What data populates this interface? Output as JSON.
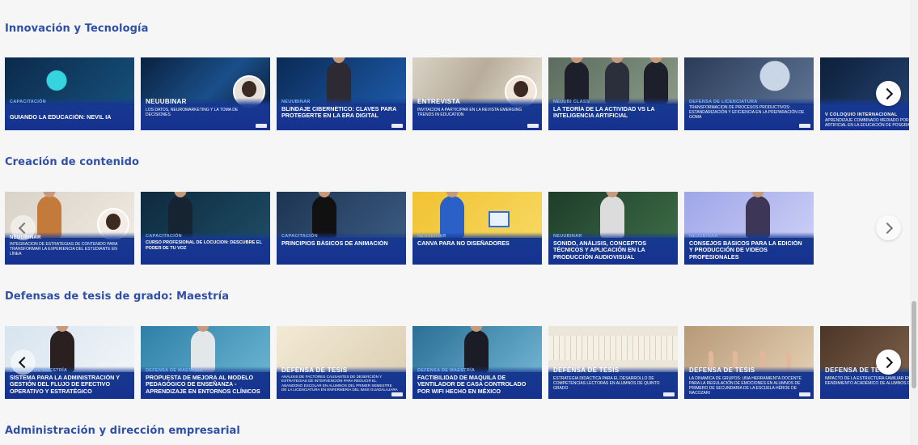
{
  "sections": [
    {
      "title": "Innovación y Tecnología",
      "cards": [
        {
          "tag": "CAPACITACIÓN",
          "title": "GUIANDO LA EDUCACIÓN: NEVIL IA"
        },
        {
          "tag": "NEUUBINAR",
          "title": "LOS DATOS, NEUROMARKETING Y LA TOMA DE DECISIONES"
        },
        {
          "tag": "NEUUBINAR",
          "title": "BLINDAJE CIBERNÉTICO: CLAVES PARA PROTEGERTE EN LA ERA DIGITAL"
        },
        {
          "tag": "ENTREVISTA",
          "title": "INVITACIÓN A PARTICIPAR EN LA REVISTA EMERGING TRENDS IN EDUCATION"
        },
        {
          "tag": "NEUUBI CLASS",
          "title": "LA TEORÍA DE LA ACTIVIDAD VS LA INTELIGENCIA ARTIFICIAL"
        },
        {
          "tag": "DEFENSA DE LICENCIATURA",
          "title": "TRANSFORMACIÓN DE PROCESOS PRODUCTIVOS: ESTANDARIZACIÓN Y EFICIENCIA EN LA PREPARACIÓN DE GOMA"
        },
        {
          "tag": "V COLOQUIO INTERNACIONAL",
          "title": "APRENDIZAJE COMBINADO MEDIADO POR INTELIGENCIA ARTIFICIAL EN LA EDUCACIÓN DE POSGRADO"
        }
      ]
    },
    {
      "title": "Creación de contenido",
      "cards": [
        {
          "tag": "NEUUBINAR",
          "title": "INTEGRACIÓN DE ESTRATEGIAS DE CONTENIDO PARA TRANSFORMAR LA EXPERIENCIA DEL ESTUDIANTE EN LÍNEA"
        },
        {
          "tag": "CAPACITACIÓN",
          "title": "CURSO PROFESIONAL DE LOCUCIÓN: DESCUBRE EL PODER DE TU VOZ"
        },
        {
          "tag": "CAPACITACIÓN",
          "title": "PRINCIPIOS BÁSICOS DE ANIMACIÓN"
        },
        {
          "tag": "NEUUBINAR",
          "title": "CANVA PARA NO DISEÑADORES"
        },
        {
          "tag": "NEUUBINAR",
          "title": "SONIDO, ANÁLISIS, CONCEPTOS TÉCNICOS Y APLICACIÓN EN LA PRODUCCIÓN AUDIOVISUAL"
        },
        {
          "tag": "NEUUBINAR",
          "title": "CONSEJOS BÁSICOS PARA LA EDICIÓN Y PRODUCCIÓN DE VIDEOS PROFESIONALES"
        }
      ]
    },
    {
      "title": "Defensas de tesis de grado: Maestría",
      "cards": [
        {
          "tag": "DEFENSA DE MAESTRÍA",
          "title": "SISTEMA PARA LA ADMINISTRACIÓN Y GESTIÓN DEL FLUJO DE EFECTIVO OPERATIVO Y ESTRATÉGICO"
        },
        {
          "tag": "DEFENSA DE MAESTRÍA",
          "title": "PROPUESTA DE MEJORA AL MODELO PEDAGÓGICO DE ENSEÑANZA - APRENDIZAJE EN ENTORNOS CLÍNICOS"
        },
        {
          "tag": "DEFENSA DE TESIS",
          "title": "ANÁLISIS DE FACTORES CAUSANTES DE DESERCIÓN Y ESTRATEGIAS DE INTERVENCIÓN PARA REDUCIR EL ABANDONO ESCOLAR EN ALUMNOS DEL PRIMER SEMESTRE DE LA LICENCIATURA EN ENFERMERÍA DEL IMSS GUADALAJARA"
        },
        {
          "tag": "DEFENSA DE MAESTRÍA",
          "title": "FACTIBILIDAD DE MAQUILA DE VENTILADOR DE CASA CONTROLADO POR WIFI HECHO EN MÉXICO"
        },
        {
          "tag": "DEFENSA DE TESIS",
          "title": "ESTRATEGIA DIDÁCTICA PARA EL DESARROLLO DE COMPETENCIAS LECTORAS EN ALUMNOS DE QUINTO GRADO"
        },
        {
          "tag": "DEFENSA DE TESIS",
          "title": "LA DINÁMICA DE GRUPOS: UNA HERRAMIENTA DOCENTE PARA LA REGULACIÓN DE EMOCIONES EN ALUMNOS DE PRIMERO DE SECUNDARIA DE LA ESCUELA HÉROE DE NACOZARI"
        },
        {
          "tag": "DEFENSA DE TESIS",
          "title": "IMPACTO DE LA ESTRUCTURA FAMILIAR EN EL RENDIMIENTO ACADÉMICO DE ALUMNOS DE SECUNDARIA"
        }
      ]
    },
    {
      "title": "Administración y dirección empresarial",
      "cards": []
    }
  ],
  "icons": {
    "next": "chevron-right-icon",
    "prev": "chevron-left-icon"
  },
  "colors": {
    "accent": "#2f4fa8",
    "banner": "#16318f"
  }
}
